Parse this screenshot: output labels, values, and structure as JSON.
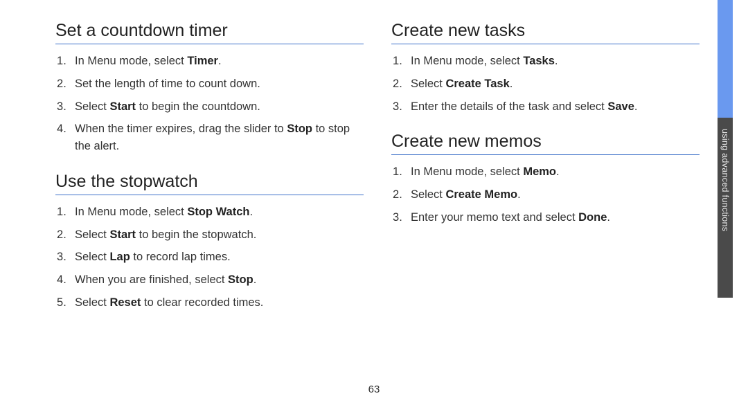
{
  "page_number": "63",
  "side_tab": {
    "label": "using advanced functions"
  },
  "left": {
    "sections": [
      {
        "title": "Set a countdown timer",
        "steps": [
          [
            {
              "t": "In Menu mode, select "
            },
            {
              "b": "Timer"
            },
            {
              "t": "."
            }
          ],
          [
            {
              "t": "Set the length of time to count down."
            }
          ],
          [
            {
              "t": "Select "
            },
            {
              "b": "Start"
            },
            {
              "t": " to begin the countdown."
            }
          ],
          [
            {
              "t": "When the timer expires, drag the slider to "
            },
            {
              "b": "Stop"
            },
            {
              "t": " to stop the alert."
            }
          ]
        ]
      },
      {
        "title": "Use the stopwatch",
        "steps": [
          [
            {
              "t": "In Menu mode, select "
            },
            {
              "b": "Stop Watch"
            },
            {
              "t": "."
            }
          ],
          [
            {
              "t": "Select "
            },
            {
              "b": "Start"
            },
            {
              "t": " to begin the stopwatch."
            }
          ],
          [
            {
              "t": "Select "
            },
            {
              "b": "Lap"
            },
            {
              "t": " to record lap times."
            }
          ],
          [
            {
              "t": "When you are finished, select "
            },
            {
              "b": "Stop"
            },
            {
              "t": "."
            }
          ],
          [
            {
              "t": "Select "
            },
            {
              "b": "Reset"
            },
            {
              "t": " to clear recorded times."
            }
          ]
        ]
      }
    ]
  },
  "right": {
    "sections": [
      {
        "title": "Create new tasks",
        "steps": [
          [
            {
              "t": "In Menu mode, select "
            },
            {
              "b": "Tasks"
            },
            {
              "t": "."
            }
          ],
          [
            {
              "t": "Select "
            },
            {
              "b": "Create Task"
            },
            {
              "t": "."
            }
          ],
          [
            {
              "t": "Enter the details of the task and select "
            },
            {
              "b": "Save"
            },
            {
              "t": "."
            }
          ]
        ]
      },
      {
        "title": "Create new memos",
        "steps": [
          [
            {
              "t": "In Menu mode, select "
            },
            {
              "b": "Memo"
            },
            {
              "t": "."
            }
          ],
          [
            {
              "t": "Select "
            },
            {
              "b": "Create Memo"
            },
            {
              "t": "."
            }
          ],
          [
            {
              "t": "Enter your memo text and select "
            },
            {
              "b": "Done"
            },
            {
              "t": "."
            }
          ]
        ]
      }
    ]
  }
}
